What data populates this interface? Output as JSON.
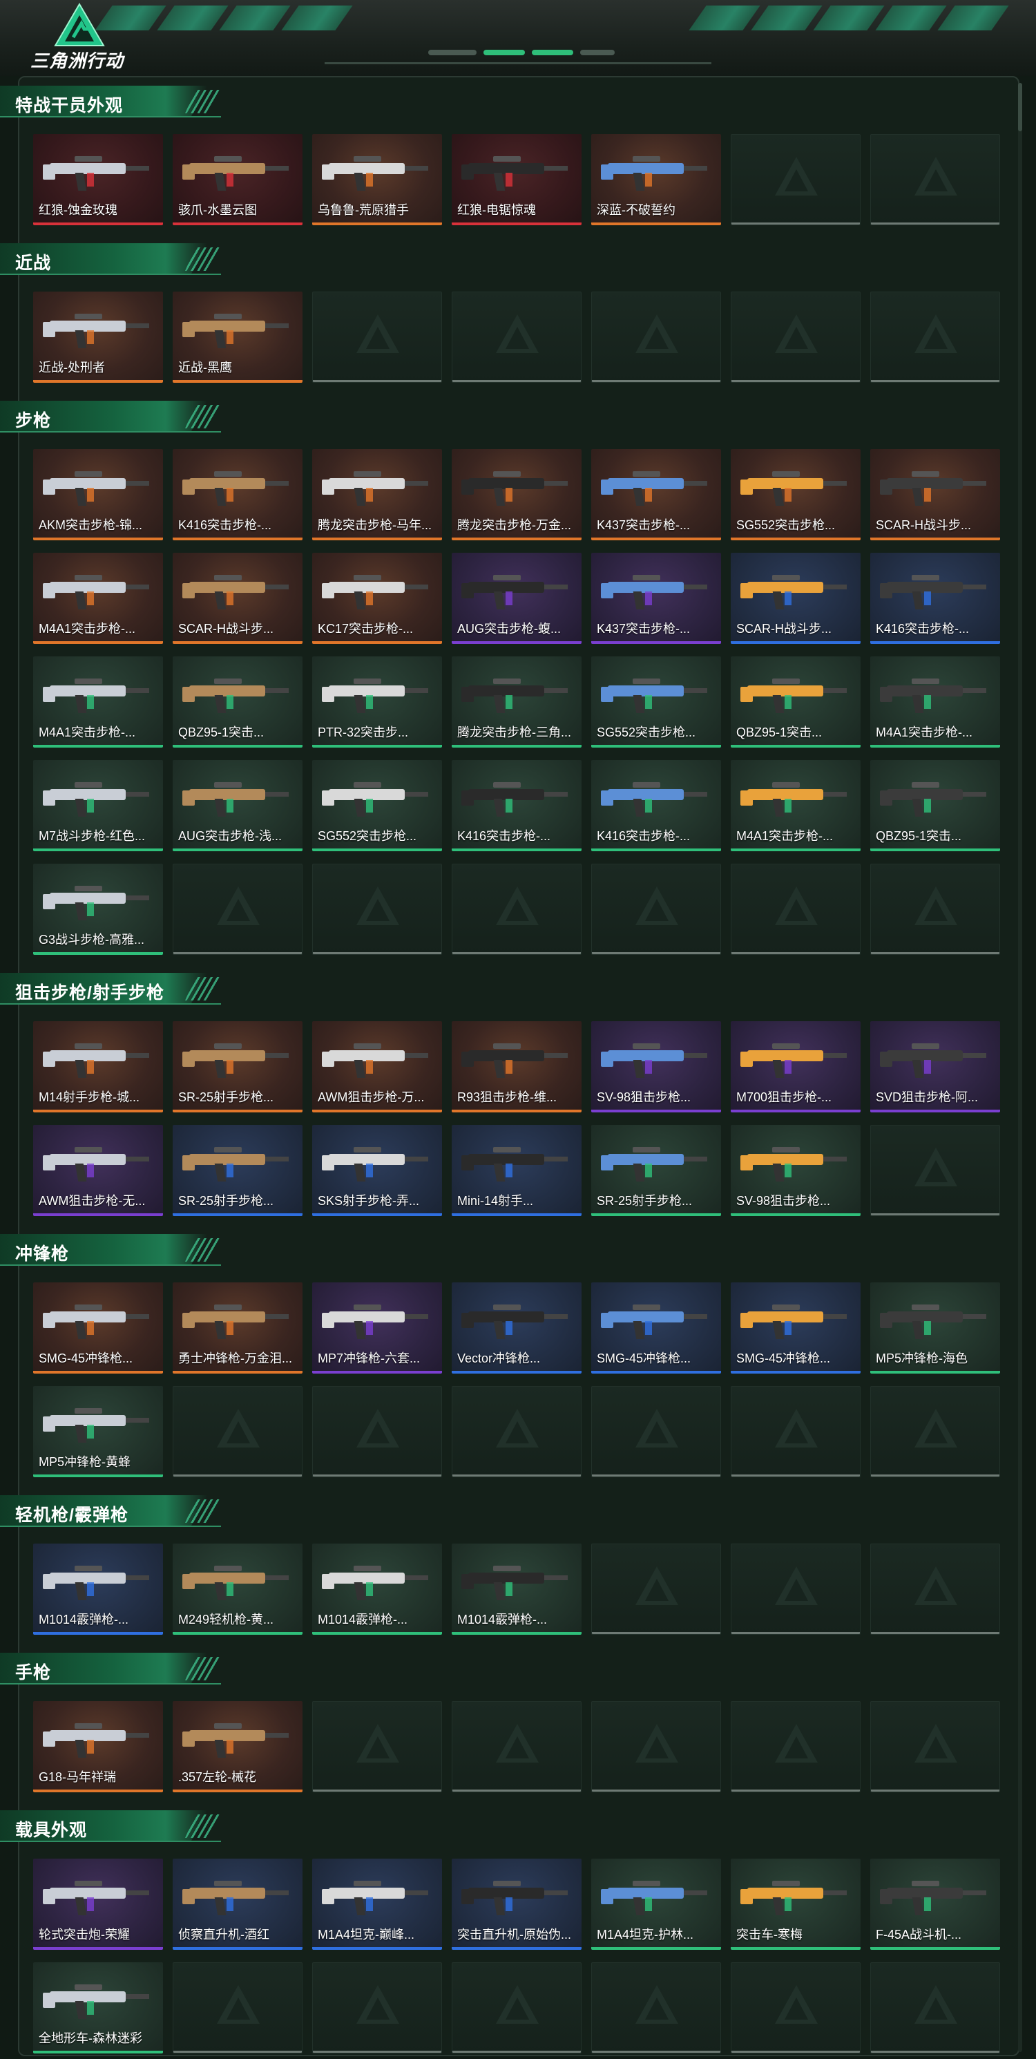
{
  "app": {
    "logo_title": "三角洲行动"
  },
  "colors": {
    "orange": "#e0762a",
    "purple": "#7a3fd0",
    "blue": "#2f6fe0",
    "green": "#2fbf7a",
    "red": "#d8323a",
    "gray": "#6e7a74"
  },
  "sections": [
    {
      "title": "特战干员外观",
      "items": [
        {
          "label": "红狼-蚀金玫瑰",
          "rarity": "red"
        },
        {
          "label": "骇爪-水墨云图",
          "rarity": "red"
        },
        {
          "label": "乌鲁鲁-荒原猎手",
          "rarity": "orange"
        },
        {
          "label": "红狼-电锯惊魂",
          "rarity": "red"
        },
        {
          "label": "深蓝-不破誓约",
          "rarity": "orange"
        }
      ],
      "empty_count": 2
    },
    {
      "title": "近战",
      "items": [
        {
          "label": "近战-处刑者",
          "rarity": "orange"
        },
        {
          "label": "近战-黑鹰",
          "rarity": "orange"
        }
      ],
      "empty_count": 5
    },
    {
      "title": "步枪",
      "items": [
        {
          "label": "AKM突击步枪-锦...",
          "rarity": "orange"
        },
        {
          "label": "K416突击步枪-...",
          "rarity": "orange"
        },
        {
          "label": "腾龙突击步枪-马年...",
          "rarity": "orange"
        },
        {
          "label": "腾龙突击步枪-万金...",
          "rarity": "orange"
        },
        {
          "label": "K437突击步枪-...",
          "rarity": "orange"
        },
        {
          "label": "SG552突击步枪...",
          "rarity": "orange"
        },
        {
          "label": "SCAR-H战斗步...",
          "rarity": "orange"
        },
        {
          "label": "M4A1突击步枪-...",
          "rarity": "orange"
        },
        {
          "label": "SCAR-H战斗步...",
          "rarity": "orange"
        },
        {
          "label": "KC17突击步枪-...",
          "rarity": "orange"
        },
        {
          "label": "AUG突击步枪-蝮...",
          "rarity": "purple"
        },
        {
          "label": "K437突击步枪-...",
          "rarity": "purple"
        },
        {
          "label": "SCAR-H战斗步...",
          "rarity": "blue"
        },
        {
          "label": "K416突击步枪-...",
          "rarity": "blue"
        },
        {
          "label": "M4A1突击步枪-...",
          "rarity": "green"
        },
        {
          "label": "QBZ95-1突击...",
          "rarity": "green"
        },
        {
          "label": "PTR-32突击步...",
          "rarity": "green"
        },
        {
          "label": "腾龙突击步枪-三角...",
          "rarity": "green"
        },
        {
          "label": "SG552突击步枪...",
          "rarity": "green"
        },
        {
          "label": "QBZ95-1突击...",
          "rarity": "green"
        },
        {
          "label": "M4A1突击步枪-...",
          "rarity": "green"
        },
        {
          "label": "M7战斗步枪-红色...",
          "rarity": "green"
        },
        {
          "label": "AUG突击步枪-浅...",
          "rarity": "green"
        },
        {
          "label": "SG552突击步枪...",
          "rarity": "green"
        },
        {
          "label": "K416突击步枪-...",
          "rarity": "green"
        },
        {
          "label": "K416突击步枪-...",
          "rarity": "green"
        },
        {
          "label": "M4A1突击步枪-...",
          "rarity": "green"
        },
        {
          "label": "QBZ95-1突击...",
          "rarity": "green"
        },
        {
          "label": "G3战斗步枪-高雅...",
          "rarity": "green"
        }
      ],
      "empty_count": 6
    },
    {
      "title": "狙击步枪/射手步枪",
      "items": [
        {
          "label": "M14射手步枪-城...",
          "rarity": "orange"
        },
        {
          "label": "SR-25射手步枪...",
          "rarity": "orange"
        },
        {
          "label": "AWM狙击步枪-万...",
          "rarity": "orange"
        },
        {
          "label": "R93狙击步枪-维...",
          "rarity": "orange"
        },
        {
          "label": "SV-98狙击步枪...",
          "rarity": "purple"
        },
        {
          "label": "M700狙击步枪-...",
          "rarity": "purple"
        },
        {
          "label": "SVD狙击步枪-阿...",
          "rarity": "purple"
        },
        {
          "label": "AWM狙击步枪-无...",
          "rarity": "purple"
        },
        {
          "label": "SR-25射手步枪...",
          "rarity": "blue"
        },
        {
          "label": "SKS射手步枪-弄...",
          "rarity": "blue"
        },
        {
          "label": "Mini-14射手...",
          "rarity": "blue"
        },
        {
          "label": "SR-25射手步枪...",
          "rarity": "green"
        },
        {
          "label": "SV-98狙击步枪...",
          "rarity": "green"
        }
      ],
      "empty_count": 1
    },
    {
      "title": "冲锋枪",
      "items": [
        {
          "label": "SMG-45冲锋枪...",
          "rarity": "orange"
        },
        {
          "label": "勇士冲锋枪-万金泪...",
          "rarity": "orange"
        },
        {
          "label": "MP7冲锋枪-六套...",
          "rarity": "purple"
        },
        {
          "label": "Vector冲锋枪...",
          "rarity": "blue"
        },
        {
          "label": "SMG-45冲锋枪...",
          "rarity": "blue"
        },
        {
          "label": "SMG-45冲锋枪...",
          "rarity": "blue"
        },
        {
          "label": "MP5冲锋枪-海色",
          "rarity": "green"
        },
        {
          "label": "MP5冲锋枪-黄蜂",
          "rarity": "green"
        }
      ],
      "empty_count": 6
    },
    {
      "title": "轻机枪/霰弹枪",
      "items": [
        {
          "label": "M1014霰弹枪-...",
          "rarity": "blue"
        },
        {
          "label": "M249轻机枪-黄...",
          "rarity": "green"
        },
        {
          "label": "M1014霰弹枪-...",
          "rarity": "green"
        },
        {
          "label": "M1014霰弹枪-...",
          "rarity": "green"
        }
      ],
      "empty_count": 3
    },
    {
      "title": "手枪",
      "items": [
        {
          "label": "G18-马年祥瑞",
          "rarity": "orange"
        },
        {
          "label": ".357左轮-械花",
          "rarity": "orange"
        }
      ],
      "empty_count": 5
    },
    {
      "title": "载具外观",
      "items": [
        {
          "label": "轮式突击炮-荣耀",
          "rarity": "purple"
        },
        {
          "label": "侦察直升机-酒红",
          "rarity": "blue"
        },
        {
          "label": "M1A4坦克-巅峰...",
          "rarity": "blue"
        },
        {
          "label": "突击直升机-原始伪...",
          "rarity": "blue"
        },
        {
          "label": "M1A4坦克-护林...",
          "rarity": "green"
        },
        {
          "label": "突击车-寒梅",
          "rarity": "green"
        },
        {
          "label": "F-45A战斗机-...",
          "rarity": "green"
        },
        {
          "label": "全地形车-森林迷彩",
          "rarity": "green"
        }
      ],
      "empty_count": 6
    }
  ]
}
